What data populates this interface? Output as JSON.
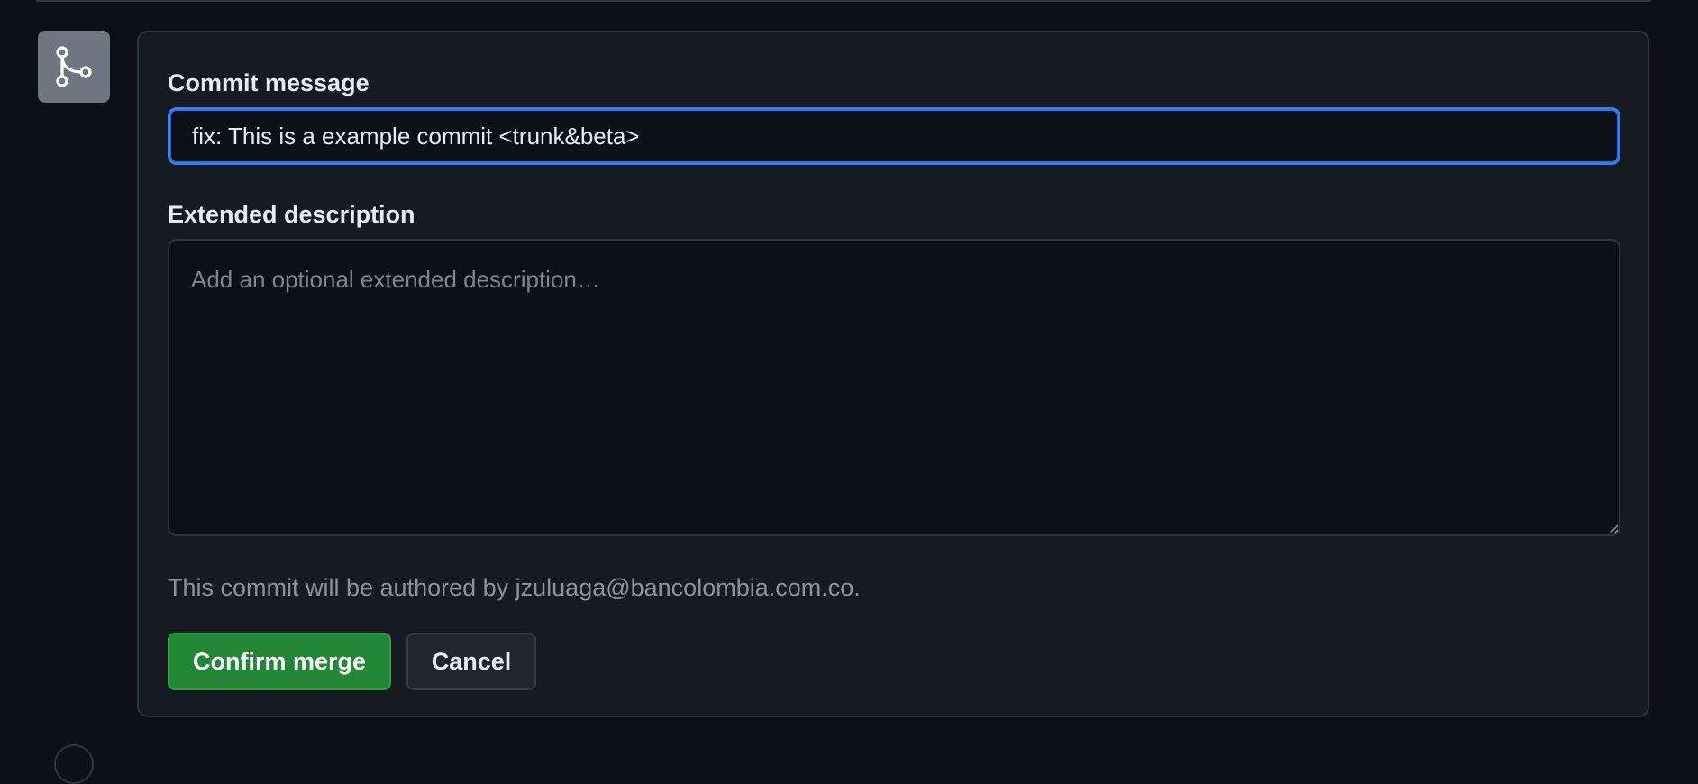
{
  "merge_box": {
    "icon": "git-merge-icon",
    "commit_message": {
      "label": "Commit message",
      "value": "fix: This is a example commit <trunk&beta>"
    },
    "extended_description": {
      "label": "Extended description",
      "placeholder": "Add an optional extended description…",
      "value": ""
    },
    "author_note": "This commit will be authored by jzuluaga@bancolombia.com.co.",
    "confirm_label": "Confirm merge",
    "cancel_label": "Cancel"
  },
  "colors": {
    "background": "#0d1117",
    "panel": "#161b22",
    "focus_border": "#2f81f7",
    "confirm_button": "#238636",
    "icon_box": "#6e7681"
  }
}
